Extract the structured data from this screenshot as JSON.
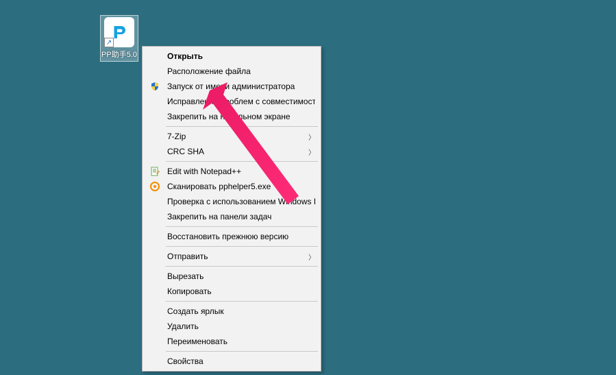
{
  "desktop_icon": {
    "label": "PP助手5.0"
  },
  "context_menu": {
    "open": "Открыть",
    "file_location": "Расположение файла",
    "run_as_admin": "Запуск от имени администратора",
    "compat_troubleshoot": "Исправление проблем с совместимостью",
    "pin_start": "Закрепить на начальном экране",
    "seven_zip": "7-Zip",
    "crc_sha": "CRC SHA",
    "edit_notepad": "Edit with Notepad++",
    "scan_file": "Сканировать pphelper5.exe",
    "defender_scan": "Проверка с использованием Windows Defender...",
    "pin_taskbar": "Закрепить на панели задач",
    "restore_prev": "Восстановить прежнюю версию",
    "send_to": "Отправить",
    "cut": "Вырезать",
    "copy": "Копировать",
    "create_shortcut": "Создать ярлык",
    "delete": "Удалить",
    "rename": "Переименовать",
    "properties": "Свойства"
  },
  "colors": {
    "desktop_bg": "#2c6e80",
    "menu_bg": "#f2f2f2",
    "arrow": "#ea1a64"
  }
}
